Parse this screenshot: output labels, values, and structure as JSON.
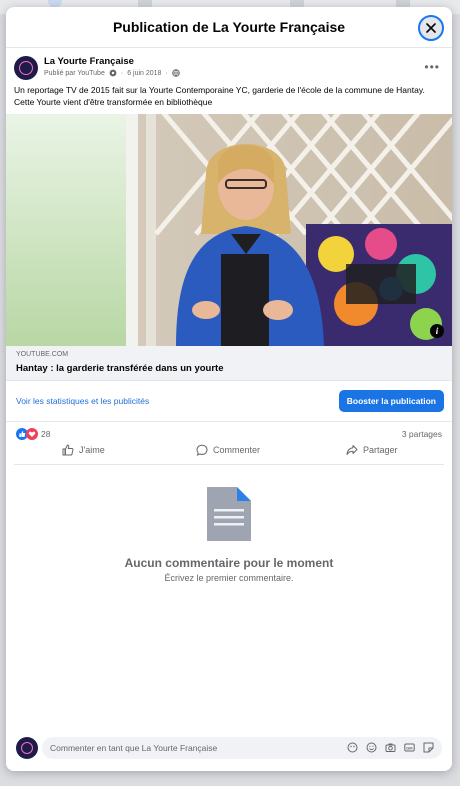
{
  "modal": {
    "title": "Publication de La Yourte Française",
    "close_icon": "close-icon"
  },
  "post": {
    "page_name": "La Yourte Française",
    "published_via": "Publié par YouTube",
    "date": "6 juin 2018",
    "text": "Un reportage TV de 2015 fait sur la Yourte Contemporaine YC,  garderie de l'école de la commune de Hantay. Cette Yourte vient d'être transformée en bibliothèque",
    "link_domain": "YOUTUBE.COM",
    "link_title": "Hantay : la garderie transférée dans un yourte",
    "stats_link": "Voir les statistiques et les publicités",
    "boost_button": "Booster la publication",
    "reaction_count": "28",
    "shares": "3 partages",
    "actions": {
      "like": "J'aime",
      "comment": "Commenter",
      "share": "Partager"
    }
  },
  "comments": {
    "empty_title": "Aucun commentaire pour le moment",
    "empty_subtitle": "Écrivez le premier commentaire.",
    "input_placeholder": "Commenter en tant que La Yourte Française"
  },
  "colors": {
    "accent": "#1b74e4",
    "link": "#216fdb"
  }
}
